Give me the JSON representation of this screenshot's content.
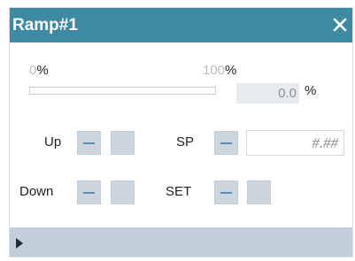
{
  "window": {
    "title": "Ramp#1",
    "close_icon": "close-icon"
  },
  "range": {
    "min_value": "0",
    "min_unit": "%",
    "max_value": "100",
    "max_unit": "%",
    "progress_fraction": 0.0
  },
  "output": {
    "value": "0.0",
    "unit": "%"
  },
  "controls": {
    "up_label": "Up",
    "down_label": "Down",
    "sp_label": "SP",
    "set_label": "SET",
    "sp_placeholder": "#.##"
  },
  "footer": {
    "expand_icon": "triangle-right-icon"
  },
  "colors": {
    "titlebar": "#3d8aa3",
    "button": "#ccd6df",
    "footer": "#c3cedb"
  }
}
